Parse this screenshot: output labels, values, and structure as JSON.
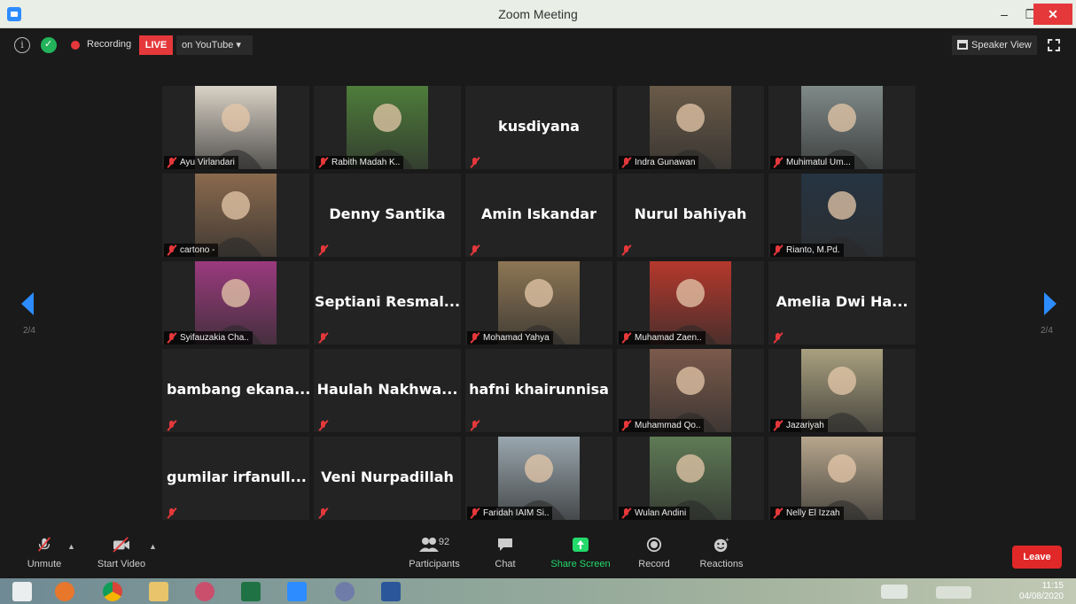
{
  "window": {
    "title": "Zoom Meeting",
    "min": "–",
    "max": "❐",
    "close": "✕"
  },
  "topbar": {
    "recording": "Recording",
    "live": "LIVE",
    "youtube": "on YouTube ▾",
    "speaker_view": "Speaker View"
  },
  "gallery": {
    "page": "2/4",
    "tiles": [
      {
        "name": "Ayu Virlandari",
        "kind": "photo",
        "photo": "#d9d2c6"
      },
      {
        "name": "Rabith Madah K..",
        "kind": "photo",
        "photo": "#4e7d3a"
      },
      {
        "name": "kusdiyana",
        "kind": "text"
      },
      {
        "name": "Indra Gunawan",
        "kind": "photo",
        "photo": "#6a5a48"
      },
      {
        "name": "Muhimatul Um...",
        "kind": "photo",
        "photo": "#7f8a88"
      },
      {
        "name": "cartono -",
        "kind": "photo",
        "photo": "#8a6a4e"
      },
      {
        "name": "Denny Santika",
        "kind": "text"
      },
      {
        "name": "Amin Iskandar",
        "kind": "text"
      },
      {
        "name": "Nurul bahiyah",
        "kind": "text"
      },
      {
        "name": "Rianto, M.Pd.",
        "kind": "photo",
        "photo": "#263442"
      },
      {
        "name": "Syifauzakia Cha..",
        "kind": "photo",
        "photo": "#9b3a7e"
      },
      {
        "name": "Septiani Resmal...",
        "kind": "text"
      },
      {
        "name": "Mohamad Yahya",
        "kind": "photo",
        "photo": "#8d7654"
      },
      {
        "name": "Muhamad Zaen..",
        "kind": "photo",
        "photo": "#b5382c"
      },
      {
        "name": "Amelia Dwi Ha...",
        "kind": "text"
      },
      {
        "name": "bambang ekana...",
        "kind": "text",
        "left": true
      },
      {
        "name": "Haulah Nakhwa...",
        "kind": "text"
      },
      {
        "name": "hafni khairunnisa",
        "kind": "text"
      },
      {
        "name": "Muhammad Qo..",
        "kind": "photo",
        "photo": "#7b5a4b"
      },
      {
        "name": "Jazariyah",
        "kind": "photo",
        "photo": "#a9a07f"
      },
      {
        "name": "gumilar irfanull...",
        "kind": "text",
        "left": true
      },
      {
        "name": "Veni Nurpadillah",
        "kind": "text"
      },
      {
        "name": "Faridah IAIM Si..",
        "kind": "photo",
        "photo": "#9aa7ae"
      },
      {
        "name": "Wulan Andini",
        "kind": "photo",
        "photo": "#5f7a55"
      },
      {
        "name": "Nelly El Izzah",
        "kind": "photo",
        "photo": "#b6a68c"
      }
    ]
  },
  "toolbar": {
    "unmute": "Unmute",
    "start_video": "Start Video",
    "participants_count": "92",
    "participants": "Participants",
    "chat": "Chat",
    "share_screen": "Share Screen",
    "record": "Record",
    "reactions": "Reactions",
    "leave": "Leave"
  },
  "taskbar": {
    "time": "11:15",
    "date": "04/08/2020"
  }
}
